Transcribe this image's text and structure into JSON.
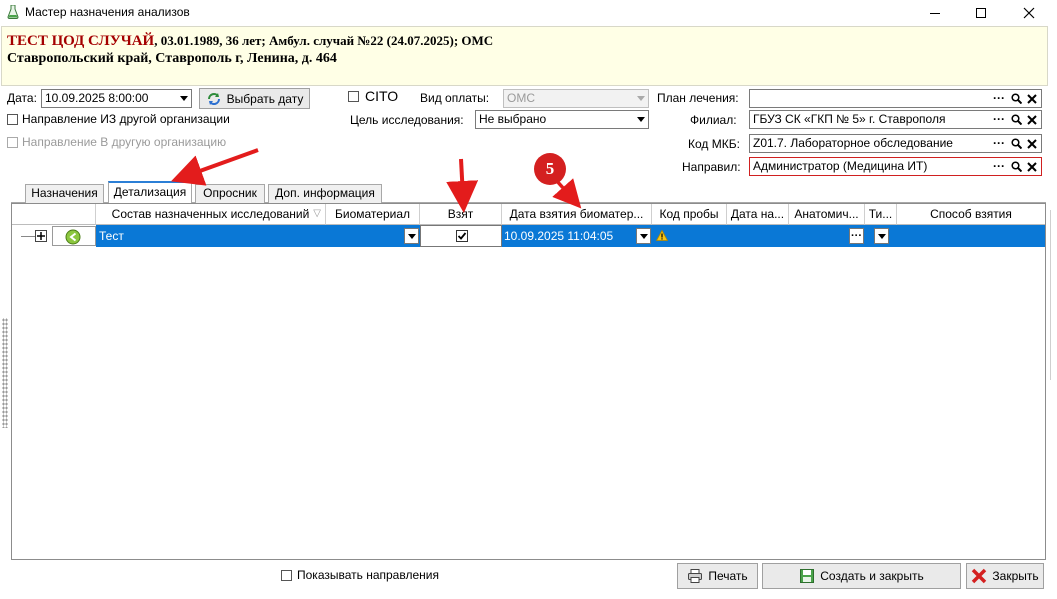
{
  "window": {
    "title": "Мастер назначения анализов",
    "minimize": "—",
    "maximize": "☐",
    "close": "✕"
  },
  "patient": {
    "name": "ТЕСТ ЦОД СЛУЧАЙ",
    "details": ", 03.01.1989, 36 лет; Амбул. случай №22 (24.07.2025); ОМС",
    "address": "Ставропольский край, Ставрополь г, Ленина, д. 464"
  },
  "form": {
    "date_label": "Дата:",
    "date_value": "10.09.2025 8:00:00",
    "pick_date_button": "Выбрать дату",
    "cito_label": "CITO",
    "payment_label": "Вид оплаты:",
    "payment_value": "ОМС",
    "purpose_label": "Цель исследования:",
    "purpose_value": "Не выбрано",
    "from_other_org": "Направление ИЗ другой организации",
    "to_other_org": "Направление В другую организацию",
    "plan_label": "План лечения:",
    "plan_value": "",
    "branch_label": "Филиал:",
    "branch_value": "ГБУЗ СК «ГКП № 5» г. Ставрополя",
    "mkb_label": "Код МКБ:",
    "mkb_value": "Z01.7. Лабораторное обследование",
    "referrer_label": "Направил:",
    "referrer_value": "Администратор (Медицина ИТ)"
  },
  "tabs": [
    "Назначения",
    "Детализация",
    "Опросник",
    "Доп. информация"
  ],
  "grid": {
    "columns": [
      "Состав назначенных исследований",
      "Биоматериал",
      "Взят",
      "Дата взятия биоматер...",
      "Код пробы",
      "Дата на...",
      "Анатомич...",
      "Ти...",
      "Способ взятия"
    ],
    "row": {
      "name": "Тест",
      "taken": true,
      "date": "10.09.2025 11:04:05"
    }
  },
  "annotation": {
    "number": "5"
  },
  "bottom": {
    "show_referrals": "Показывать направления",
    "print_button": "Печать",
    "create_close_button": "Создать и закрыть",
    "close_button": "Закрыть"
  }
}
